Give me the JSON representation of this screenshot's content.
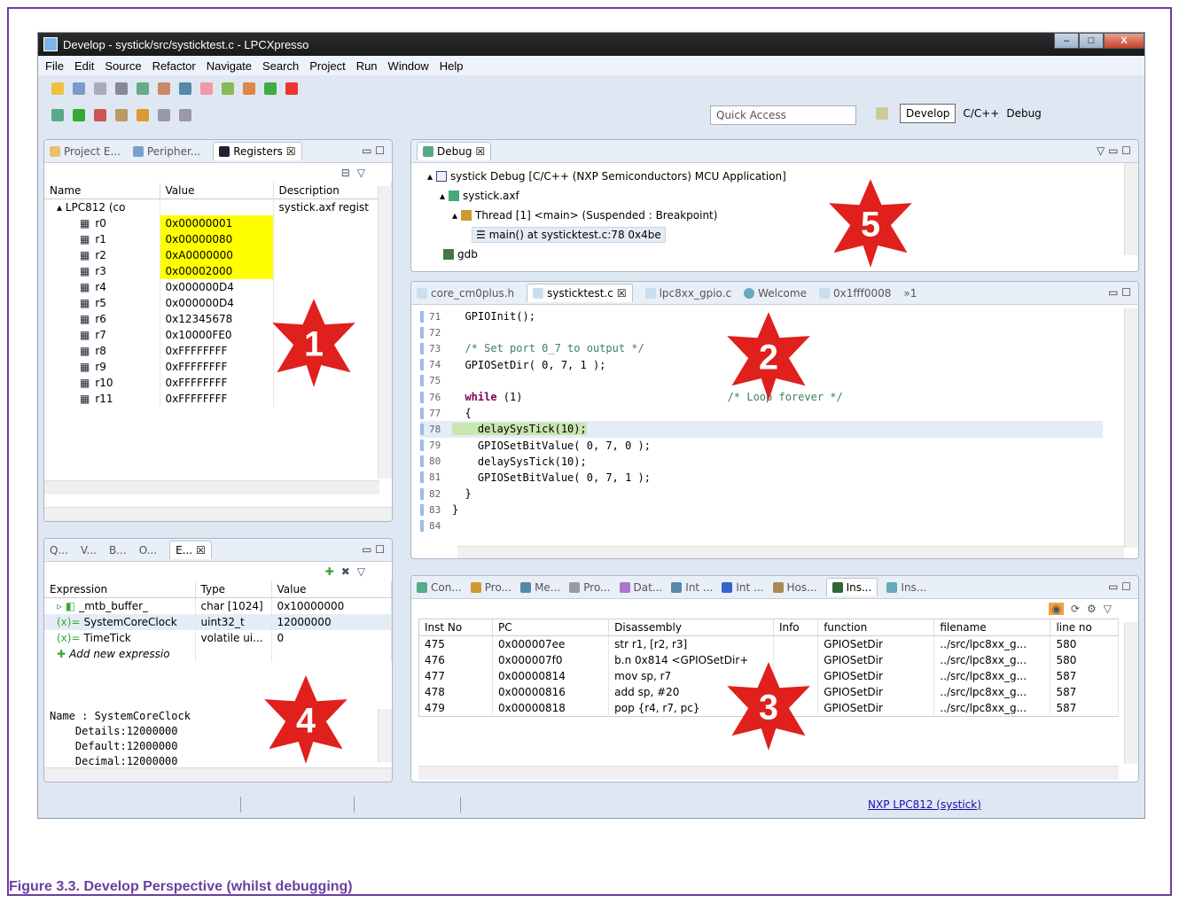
{
  "window": {
    "title": "Develop - systick/src/systicktest.c - LPCXpresso",
    "min": "–",
    "max": "□",
    "close": "X"
  },
  "menu": [
    "File",
    "Edit",
    "Source",
    "Refactor",
    "Navigate",
    "Search",
    "Project",
    "Run",
    "Window",
    "Help"
  ],
  "toolbar": {
    "quick_access": "Quick Access",
    "perspectives": [
      "Develop",
      "C/C++",
      "Debug"
    ]
  },
  "registers_pane": {
    "tabs": [
      "Project E...",
      "Peripher...",
      "Registers"
    ],
    "columns": [
      "Name",
      "Value",
      "Description"
    ],
    "root": {
      "name": "LPC812 (co",
      "desc": "systick.axf regist"
    },
    "rows": [
      {
        "name": "r0",
        "value": "0x00000001",
        "highlight": true
      },
      {
        "name": "r1",
        "value": "0x00000080",
        "highlight": true
      },
      {
        "name": "r2",
        "value": "0xA0000000",
        "highlight": true
      },
      {
        "name": "r3",
        "value": "0x00002000",
        "highlight": true
      },
      {
        "name": "r4",
        "value": "0x000000D4",
        "highlight": false
      },
      {
        "name": "r5",
        "value": "0x000000D4",
        "highlight": false
      },
      {
        "name": "r6",
        "value": "0x12345678",
        "highlight": false
      },
      {
        "name": "r7",
        "value": "0x10000FE0",
        "highlight": false
      },
      {
        "name": "r8",
        "value": "0xFFFFFFFF",
        "highlight": false
      },
      {
        "name": "r9",
        "value": "0xFFFFFFFF",
        "highlight": false
      },
      {
        "name": "r10",
        "value": "0xFFFFFFFF",
        "highlight": false
      },
      {
        "name": "r11",
        "value": "0xFFFFFFFF",
        "highlight": false
      }
    ]
  },
  "debug_pane": {
    "tab": "Debug",
    "tree": [
      "systick Debug [C/C++ (NXP Semiconductors) MCU Application]",
      "systick.axf",
      "Thread [1] <main> (Suspended : Breakpoint)",
      "main() at systicktest.c:78 0x4be",
      "gdb"
    ]
  },
  "editor_pane": {
    "tabs": [
      "core_cm0plus.h",
      "systicktest.c",
      "lpc8xx_gpio.c",
      "Welcome",
      "0x1fff0008",
      "»1"
    ],
    "lines": [
      {
        "n": "71",
        "t": "  GPIOInit();"
      },
      {
        "n": "72",
        "t": ""
      },
      {
        "n": "73",
        "t": "  /* Set port 0_7 to output */"
      },
      {
        "n": "74",
        "t": "  GPIOSetDir( 0, 7, 1 );"
      },
      {
        "n": "75",
        "t": ""
      },
      {
        "n": "76",
        "t": "  while (1)                                /* Loop forever */"
      },
      {
        "n": "77",
        "t": "  {"
      },
      {
        "n": "78",
        "t": "    delaySysTick(10);"
      },
      {
        "n": "79",
        "t": "    GPIOSetBitValue( 0, 7, 0 );"
      },
      {
        "n": "80",
        "t": "    delaySysTick(10);"
      },
      {
        "n": "81",
        "t": "    GPIOSetBitValue( 0, 7, 1 );"
      },
      {
        "n": "82",
        "t": "  }"
      },
      {
        "n": "83",
        "t": "}"
      },
      {
        "n": "84",
        "t": ""
      }
    ]
  },
  "expressions_pane": {
    "tabs": [
      "Q...",
      "V...",
      "B...",
      "O...",
      "E..."
    ],
    "columns": [
      "Expression",
      "Type",
      "Value"
    ],
    "rows": [
      {
        "expr": "_mtb_buffer_",
        "type": "char [1024]",
        "value": "0x10000000"
      },
      {
        "expr": "SystemCoreClock",
        "type": "uint32_t",
        "value": "12000000"
      },
      {
        "expr": "TimeTick",
        "type": "volatile ui...",
        "value": "0"
      },
      {
        "expr": "Add new expressio",
        "type": "",
        "value": ""
      }
    ],
    "detail": "Name : SystemCoreClock\n    Details:12000000\n    Default:12000000\n    Decimal:12000000"
  },
  "trace_pane": {
    "tabs": [
      "Con...",
      "Pro...",
      "Me...",
      "Pro...",
      "Dat...",
      "Int ...",
      "Int ...",
      "Hos...",
      "Ins...",
      "Ins..."
    ],
    "columns": [
      "Inst No",
      "PC",
      "Disassembly",
      "Info",
      "function",
      "filename",
      "line no"
    ],
    "rows": [
      [
        "475",
        "0x000007ee",
        "str r1, [r2, r3]",
        "",
        "GPIOSetDir",
        "../src/lpc8xx_g...",
        "580"
      ],
      [
        "476",
        "0x000007f0",
        "b.n 0x814 <GPIOSetDir+",
        "",
        "GPIOSetDir",
        "../src/lpc8xx_g...",
        "580"
      ],
      [
        "477",
        "0x00000814",
        "mov sp, r7",
        "",
        "GPIOSetDir",
        "../src/lpc8xx_g...",
        "587"
      ],
      [
        "478",
        "0x00000816",
        "add sp, #20",
        "",
        "GPIOSetDir",
        "../src/lpc8xx_g...",
        "587"
      ],
      [
        "479",
        "0x00000818",
        "pop {r4, r7, pc}",
        "",
        "GPIOSetDir",
        "../src/lpc8xx_g...",
        "587"
      ]
    ]
  },
  "status": {
    "link1": "NXP",
    "link2": "LPC812",
    "link3": "systick"
  },
  "markers": [
    "1",
    "2",
    "3",
    "4",
    "5"
  ],
  "caption": "Figure 3.3. Develop Perspective (whilst debugging)",
  "colors": {
    "frame": "#6b3fa0",
    "star": "#e0201c",
    "highlight": "#ffff00",
    "current_line": "#c8e6b0"
  }
}
